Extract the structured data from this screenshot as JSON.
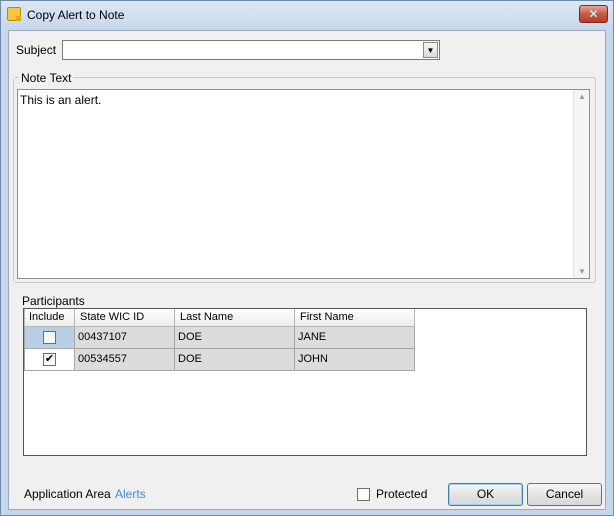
{
  "window": {
    "title": "Copy Alert to Note",
    "close_glyph": "✕"
  },
  "subject": {
    "label": "Subject",
    "value": ""
  },
  "note": {
    "legend": "Note Text",
    "value": "This is an alert."
  },
  "participants": {
    "label": "Participants",
    "columns": [
      "Include",
      "State WIC ID",
      "Last Name",
      "First Name"
    ],
    "rows": [
      {
        "include": false,
        "wic_id": "00437107",
        "last_name": "DOE",
        "first_name": "JANE"
      },
      {
        "include": true,
        "wic_id": "00534557",
        "last_name": "DOE",
        "first_name": "JOHN"
      }
    ]
  },
  "footer": {
    "app_area_label": "Application Area",
    "app_area_value": "Alerts",
    "protected_label": "Protected",
    "protected_checked": false,
    "ok_label": "OK",
    "cancel_label": "Cancel"
  },
  "colors": {
    "link": "#3a8ed8",
    "selected_cell": "#b9cfe8"
  }
}
